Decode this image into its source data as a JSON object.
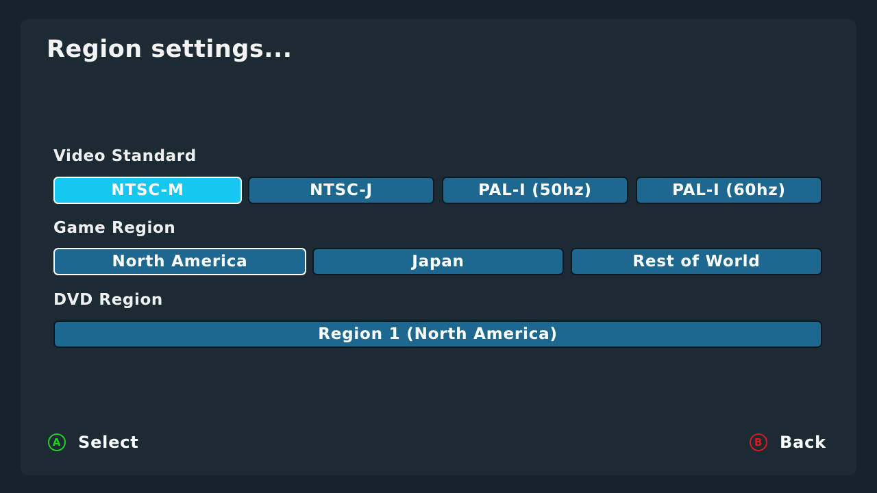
{
  "title": "Region settings...",
  "video_standard": {
    "label": "Video Standard",
    "options": [
      "NTSC-M",
      "NTSC-J",
      "PAL-I (50hz)",
      "PAL-I (60hz)"
    ],
    "focused": "NTSC-M"
  },
  "game_region": {
    "label": "Game Region",
    "options": [
      "North America",
      "Japan",
      "Rest of World"
    ],
    "selected": "North America"
  },
  "dvd_region": {
    "label": "DVD Region",
    "value": "Region 1 (North America)"
  },
  "footer": {
    "select": {
      "button": "A",
      "label": "Select"
    },
    "back": {
      "button": "B",
      "label": "Back"
    }
  },
  "colors": {
    "background": "#1b2a33",
    "option": "#1e6890",
    "focused": "#16c8f0",
    "a_button": "#1fd11f",
    "b_button": "#d61c1c"
  }
}
